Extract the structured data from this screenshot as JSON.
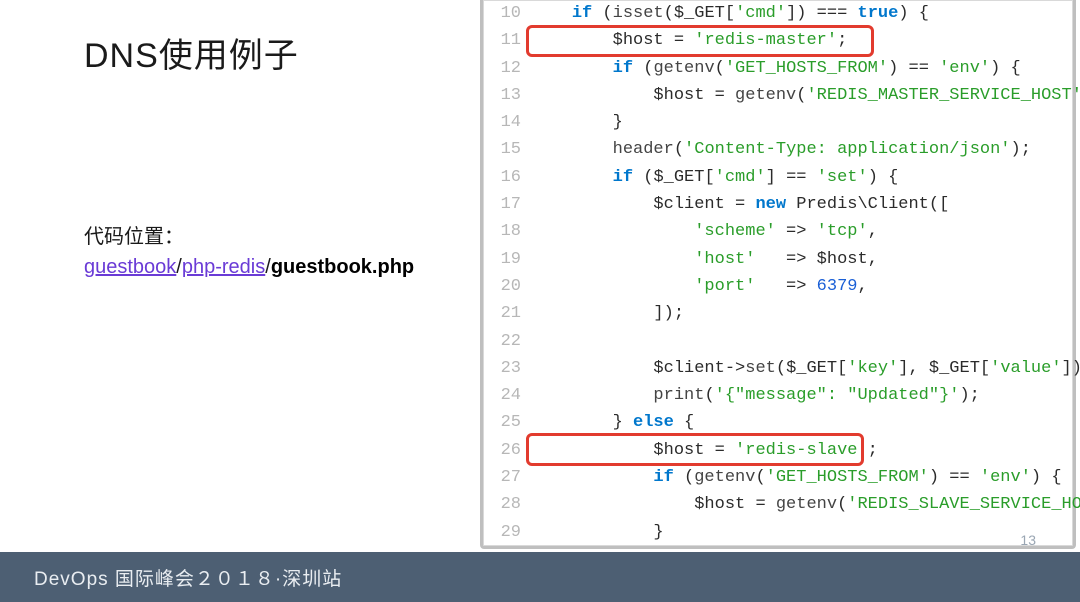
{
  "title": "DNS使用例子",
  "codeLocation": {
    "label": "代码位置：",
    "link1": "guestbook",
    "sep": "/",
    "link2": "php-redis",
    "file": "guestbook.php"
  },
  "code": [
    {
      "n": "10",
      "tokens": [
        [
          "text",
          "    "
        ],
        [
          "kw",
          "if"
        ],
        [
          "pun",
          " ("
        ],
        [
          "fn",
          "isset"
        ],
        [
          "pun",
          "("
        ],
        [
          "var",
          "$_GET"
        ],
        [
          "pun",
          "["
        ],
        [
          "str",
          "'cmd'"
        ],
        [
          "pun",
          "]) === "
        ],
        [
          "kw",
          "true"
        ],
        [
          "pun",
          ") {"
        ]
      ]
    },
    {
      "n": "11",
      "tokens": [
        [
          "text",
          "        "
        ],
        [
          "var",
          "$host"
        ],
        [
          "pun",
          " = "
        ],
        [
          "str",
          "'redis-master'"
        ],
        [
          "pun",
          ";"
        ]
      ]
    },
    {
      "n": "12",
      "tokens": [
        [
          "text",
          "        "
        ],
        [
          "kw",
          "if"
        ],
        [
          "pun",
          " ("
        ],
        [
          "fn",
          "getenv"
        ],
        [
          "pun",
          "("
        ],
        [
          "str",
          "'GET_HOSTS_FROM'"
        ],
        [
          "pun",
          ") == "
        ],
        [
          "str",
          "'env'"
        ],
        [
          "pun",
          ") {"
        ]
      ]
    },
    {
      "n": "13",
      "tokens": [
        [
          "text",
          "            "
        ],
        [
          "var",
          "$host"
        ],
        [
          "pun",
          " = "
        ],
        [
          "fn",
          "getenv"
        ],
        [
          "pun",
          "("
        ],
        [
          "str",
          "'REDIS_MASTER_SERVICE_HOST'"
        ],
        [
          "pun",
          ");"
        ]
      ]
    },
    {
      "n": "14",
      "tokens": [
        [
          "text",
          "        "
        ],
        [
          "pun",
          "}"
        ]
      ]
    },
    {
      "n": "15",
      "tokens": [
        [
          "text",
          "        "
        ],
        [
          "fn",
          "header"
        ],
        [
          "pun",
          "("
        ],
        [
          "str",
          "'Content-Type: application/json'"
        ],
        [
          "pun",
          ");"
        ]
      ]
    },
    {
      "n": "16",
      "tokens": [
        [
          "text",
          "        "
        ],
        [
          "kw",
          "if"
        ],
        [
          "pun",
          " ("
        ],
        [
          "var",
          "$_GET"
        ],
        [
          "pun",
          "["
        ],
        [
          "str",
          "'cmd'"
        ],
        [
          "pun",
          "] == "
        ],
        [
          "str",
          "'set'"
        ],
        [
          "pun",
          ") {"
        ]
      ]
    },
    {
      "n": "17",
      "tokens": [
        [
          "text",
          "            "
        ],
        [
          "var",
          "$client"
        ],
        [
          "pun",
          " = "
        ],
        [
          "newkw",
          "new"
        ],
        [
          "pun",
          " Predis\\\\Client(["
        ]
      ]
    },
    {
      "n": "18",
      "tokens": [
        [
          "text",
          "                "
        ],
        [
          "str",
          "'scheme'"
        ],
        [
          "pun",
          " => "
        ],
        [
          "str",
          "'tcp'"
        ],
        [
          "pun",
          ","
        ]
      ]
    },
    {
      "n": "19",
      "tokens": [
        [
          "text",
          "                "
        ],
        [
          "str",
          "'host'"
        ],
        [
          "pun",
          "   => "
        ],
        [
          "var",
          "$host"
        ],
        [
          "pun",
          ","
        ]
      ]
    },
    {
      "n": "20",
      "tokens": [
        [
          "text",
          "                "
        ],
        [
          "str",
          "'port'"
        ],
        [
          "pun",
          "   => "
        ],
        [
          "num",
          "6379"
        ],
        [
          "pun",
          ","
        ]
      ]
    },
    {
      "n": "21",
      "tokens": [
        [
          "text",
          "            "
        ],
        [
          "pun",
          "]);"
        ]
      ]
    },
    {
      "n": "22",
      "tokens": [
        [
          "text",
          ""
        ]
      ]
    },
    {
      "n": "23",
      "tokens": [
        [
          "text",
          "            "
        ],
        [
          "var",
          "$client"
        ],
        [
          "pun",
          "->"
        ],
        [
          "fn",
          "set"
        ],
        [
          "pun",
          "("
        ],
        [
          "var",
          "$_GET"
        ],
        [
          "pun",
          "["
        ],
        [
          "str",
          "'key'"
        ],
        [
          "pun",
          "], "
        ],
        [
          "var",
          "$_GET"
        ],
        [
          "pun",
          "["
        ],
        [
          "str",
          "'value'"
        ],
        [
          "pun",
          "]);"
        ]
      ]
    },
    {
      "n": "24",
      "tokens": [
        [
          "text",
          "            "
        ],
        [
          "fn",
          "print"
        ],
        [
          "pun",
          "("
        ],
        [
          "str",
          "'{\"message\": \"Updated\"}'"
        ],
        [
          "pun",
          ");"
        ]
      ]
    },
    {
      "n": "25",
      "tokens": [
        [
          "text",
          "        "
        ],
        [
          "pun",
          "} "
        ],
        [
          "kw",
          "else"
        ],
        [
          "pun",
          " {"
        ]
      ]
    },
    {
      "n": "26",
      "tokens": [
        [
          "text",
          "            "
        ],
        [
          "var",
          "$host"
        ],
        [
          "pun",
          " = "
        ],
        [
          "str",
          "'redis-slave'"
        ],
        [
          "pun",
          ";"
        ]
      ]
    },
    {
      "n": "27",
      "tokens": [
        [
          "text",
          "            "
        ],
        [
          "kw",
          "if"
        ],
        [
          "pun",
          " ("
        ],
        [
          "fn",
          "getenv"
        ],
        [
          "pun",
          "("
        ],
        [
          "str",
          "'GET_HOSTS_FROM'"
        ],
        [
          "pun",
          ") == "
        ],
        [
          "str",
          "'env'"
        ],
        [
          "pun",
          ") {"
        ]
      ]
    },
    {
      "n": "28",
      "tokens": [
        [
          "text",
          "                "
        ],
        [
          "var",
          "$host"
        ],
        [
          "pun",
          " = "
        ],
        [
          "fn",
          "getenv"
        ],
        [
          "pun",
          "("
        ],
        [
          "str",
          "'REDIS_SLAVE_SERVICE_HOST'"
        ],
        [
          "pun",
          ");"
        ]
      ]
    },
    {
      "n": "29",
      "tokens": [
        [
          "text",
          "            "
        ],
        [
          "pun",
          "}"
        ]
      ]
    }
  ],
  "footer": "DevOps 国际峰会２０１８·深圳站",
  "pageNum": "13"
}
